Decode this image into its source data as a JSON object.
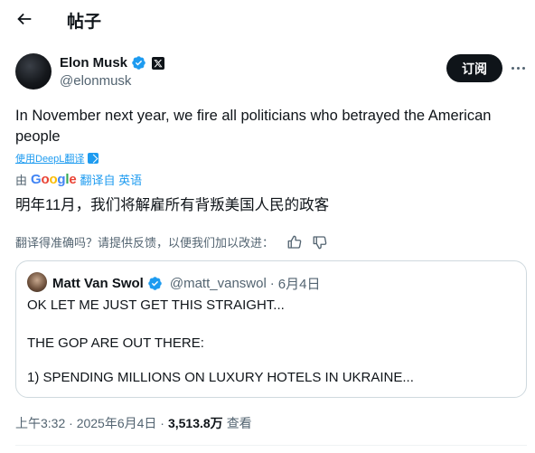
{
  "header": {
    "title": "帖子"
  },
  "author": {
    "name": "Elon Musk",
    "handle": "@elonmusk",
    "follow_label": "订阅"
  },
  "tweet": {
    "text": "In November next year, we fire all politicians who betrayed the American people",
    "deepl_label": "使用DeepL翻译",
    "translate_by": "由",
    "google_brand": "Google",
    "translate_source": "翻译自 英语",
    "translated_text": "明年11月，我们将解雇所有背叛美国人民的政客",
    "feedback_prompt": "翻译得准确吗？请提供反馈，以便我们加以改进："
  },
  "quote": {
    "name": "Matt Van Swol",
    "handle": "@matt_vanswol",
    "dot": "·",
    "date": "6月4日",
    "lines": [
      "OK LET ME JUST GET THIS STRAIGHT...",
      "THE GOP ARE OUT THERE:",
      "1) SPENDING MILLIONS ON LUXURY HOTELS IN UKRAINE..."
    ]
  },
  "meta": {
    "time_date": "上午3:32 · 2025年6月4日 ·",
    "views_count": "3,513.8万",
    "views_label": "查看"
  },
  "colors": {
    "accent": "#1d9bf0",
    "text": "#0f1419",
    "muted": "#536471",
    "border": "#cfd9de"
  }
}
